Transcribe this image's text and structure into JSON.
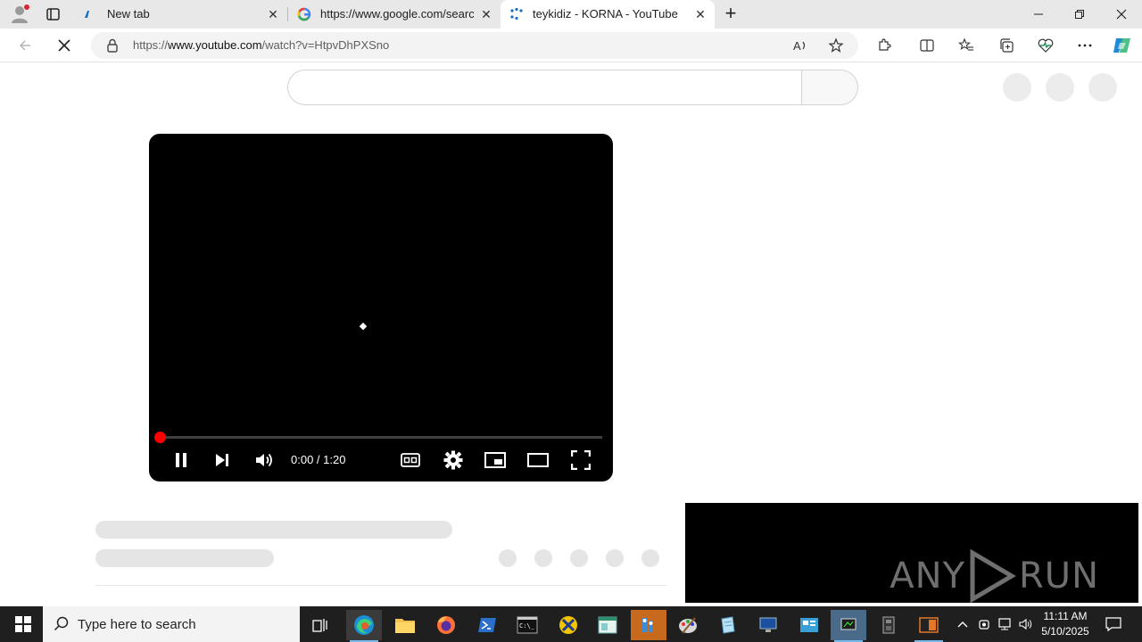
{
  "browser": {
    "tabs": [
      {
        "title": "New tab",
        "close": "✕",
        "icon": "edge-newtab-icon"
      },
      {
        "title": "https://www.google.com/search",
        "close": "✕",
        "icon": "google-icon"
      },
      {
        "title": "teykidiz - KORNA - YouTube",
        "close": "✕",
        "icon": "loading-icon"
      }
    ],
    "new_tab": "+",
    "address": {
      "scheme": "https://",
      "host": "www.youtube.com",
      "path": "/watch?v=HtpvDhPXSno"
    }
  },
  "player": {
    "time": "0:00 / 1:20",
    "progress_fraction": 0.0
  },
  "watermark": {
    "left": "ANY",
    "right": "RUN"
  },
  "taskbar": {
    "search_placeholder": "Type here to search",
    "time": "11:11 AM",
    "date": "5/10/2025"
  },
  "colors": {
    "progress": "#ff0000",
    "taskbar": "#1f1f1f",
    "tab_strip": "#e8e8e8"
  }
}
